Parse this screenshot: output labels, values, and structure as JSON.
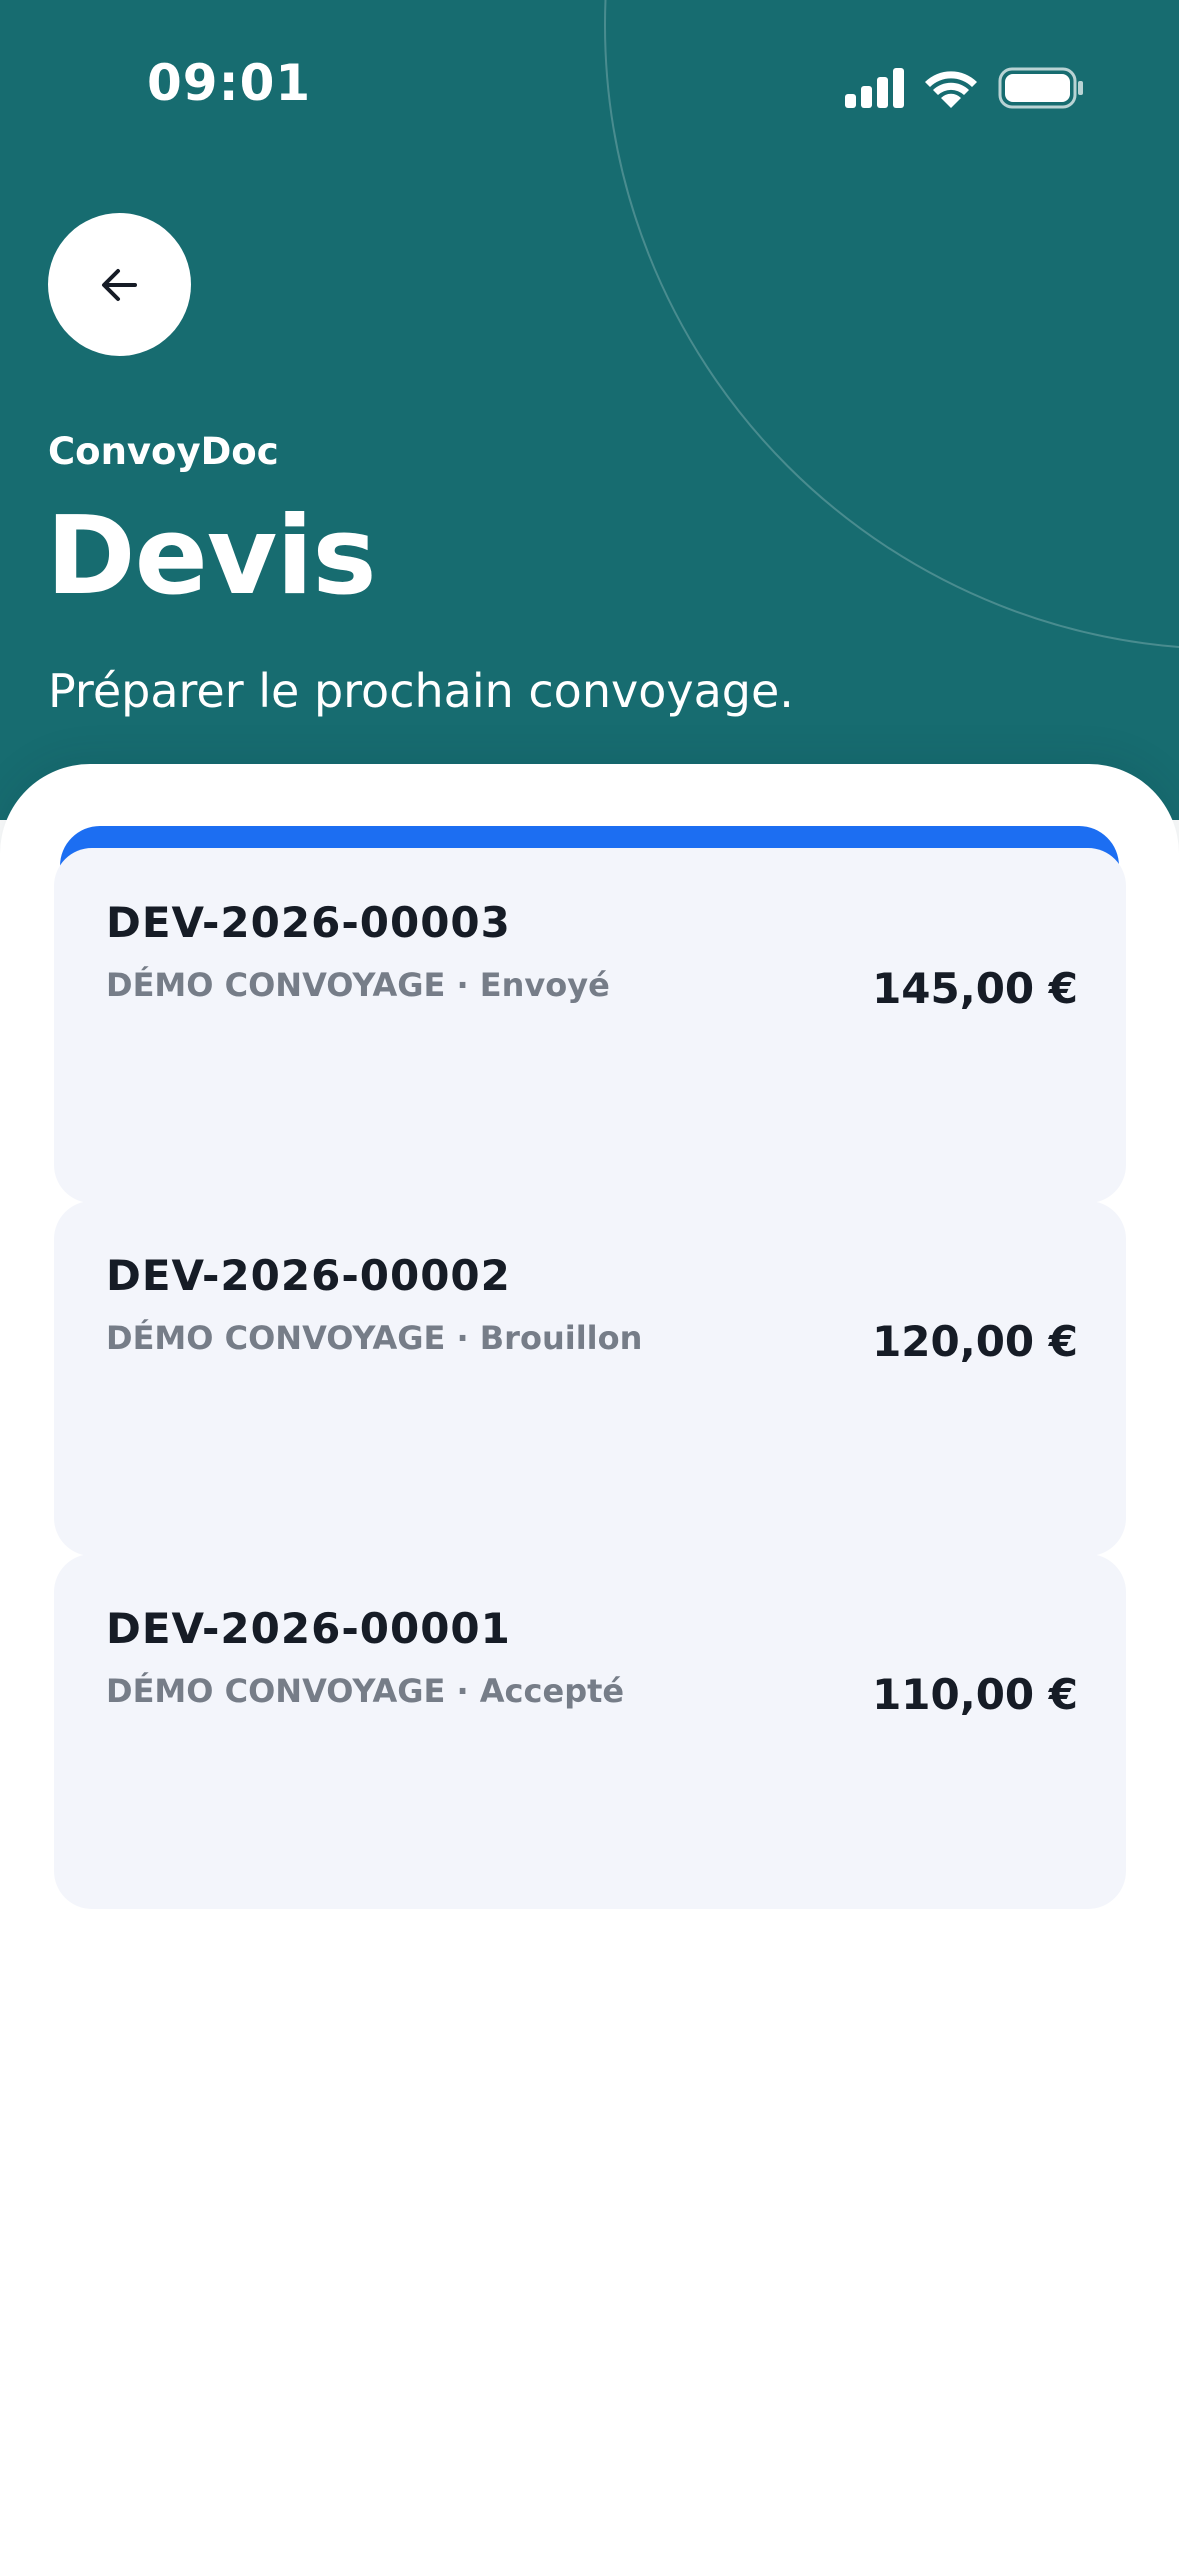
{
  "status_bar": {
    "time": "09:01",
    "icons": [
      "cellular-signal-icon",
      "wifi-icon",
      "battery-icon"
    ]
  },
  "header": {
    "app_name": "ConvoyDoc",
    "title": "Devis",
    "subtitle": "Préparer le prochain convoyage.",
    "back_icon": "arrow-left-icon"
  },
  "colors": {
    "header_background": "#176c70",
    "accent": "#1c6ef2",
    "card_background": "#f3f5fb",
    "primary_text": "#161c26",
    "secondary_text": "#767d88"
  },
  "quotes": [
    {
      "number": "DEV-2026-00003",
      "meta": "DÉMO CONVOYAGE · Envoyé",
      "amount": "145,00 €"
    },
    {
      "number": "DEV-2026-00002",
      "meta": "DÉMO CONVOYAGE · Brouillon",
      "amount": "120,00 €"
    },
    {
      "number": "DEV-2026-00001",
      "meta": "DÉMO CONVOYAGE · Accepté",
      "amount": "110,00 €"
    }
  ]
}
